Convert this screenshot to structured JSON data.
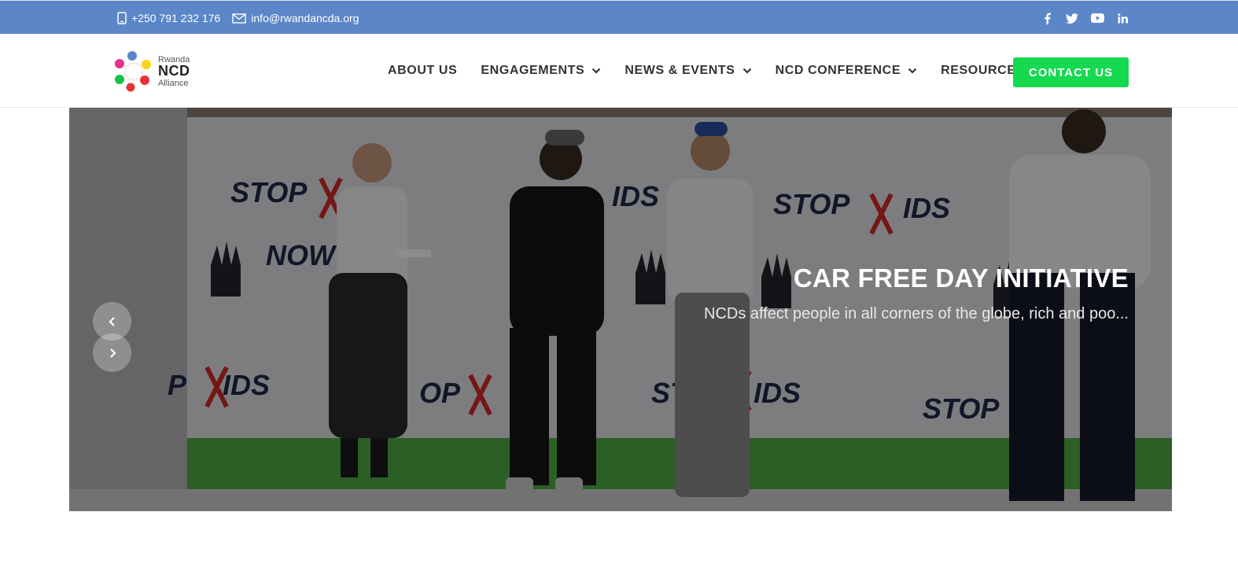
{
  "topbar": {
    "phone": "+250 791 232 176",
    "email": "info@rwandancda.org",
    "social": [
      "facebook-icon",
      "twitter-icon",
      "youtube-icon",
      "linkedin-icon"
    ]
  },
  "logo": {
    "line1": "Rwanda",
    "line2": "NCD",
    "line3": "Alliance"
  },
  "nav": {
    "items": [
      {
        "label": "ABOUT US",
        "dropdown": false
      },
      {
        "label": "ENGAGEMENTS",
        "dropdown": true
      },
      {
        "label": "NEWS & EVENTS",
        "dropdown": true
      },
      {
        "label": "NCD CONFERENCE",
        "dropdown": true
      },
      {
        "label": "RESOURCES",
        "dropdown": true
      }
    ],
    "contact_label": "CONTACT US"
  },
  "hero": {
    "title": "CAR FREE DAY INITIATIVE",
    "text": "NCDs affect people in all corners of the globe, rich and poo...",
    "banner_words": [
      "STOP AIDS",
      "NOW!"
    ]
  },
  "colors": {
    "topbar": "#5b87c9",
    "accent_button": "#15d94f",
    "nav_text": "#333333"
  }
}
